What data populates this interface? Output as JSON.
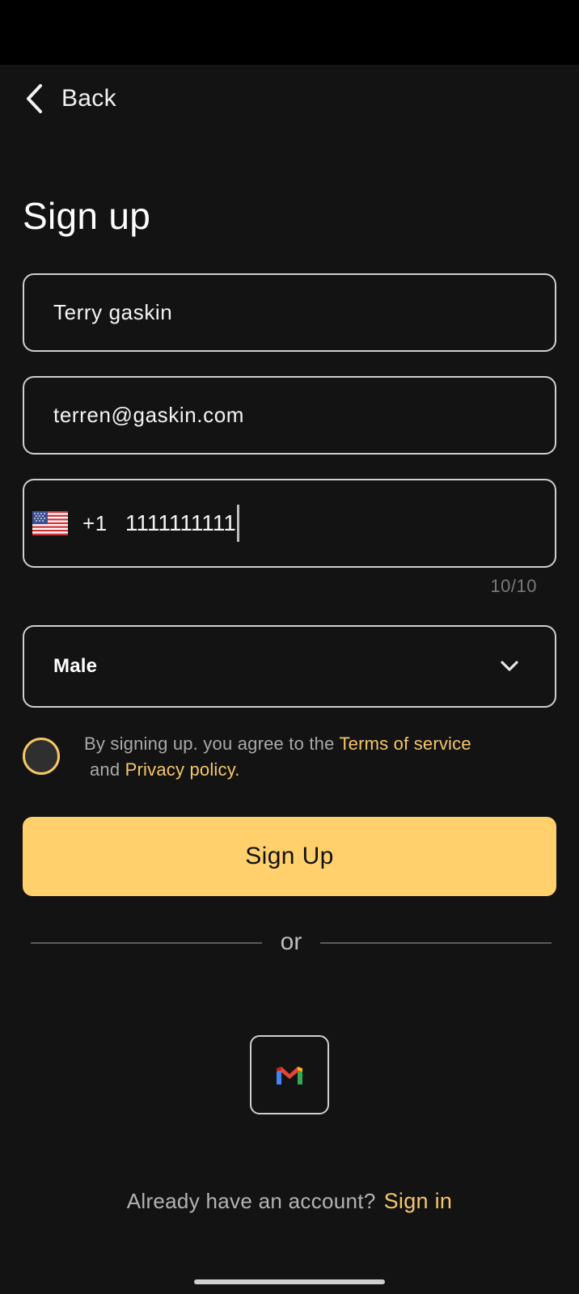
{
  "header": {
    "back_label": "Back",
    "back_icon": "chevron-left-icon"
  },
  "page": {
    "title": "Sign up"
  },
  "form": {
    "name_value": "Terry gaskin",
    "email_value": "terren@gaskin.com",
    "phone": {
      "flag_icon": "us-flag-icon",
      "dial_code": "+1",
      "number": "1111111111",
      "counter": "10/10"
    },
    "gender": {
      "selected": "Male",
      "dropdown_icon": "chevron-down-icon"
    }
  },
  "agreement": {
    "text_before": "By signing up. you agree to the ",
    "terms_link": "Terms of service",
    "text_and": "and ",
    "privacy_link": "Privacy policy.",
    "checked": false
  },
  "actions": {
    "signup_label": "Sign Up",
    "divider_label": "or",
    "gmail_icon": "gmail-icon"
  },
  "footer": {
    "prompt": "Already have an account?",
    "signin_link": "Sign in"
  },
  "colors": {
    "background": "#131313",
    "accent": "#ffd06c",
    "link": "#f5c76a",
    "field_border": "#cfcfcf"
  }
}
